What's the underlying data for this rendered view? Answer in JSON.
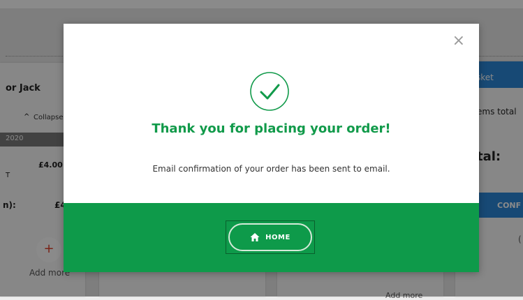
{
  "background": {
    "left_card": {
      "title": "or Jack",
      "collapse": "Collapse",
      "date": "2020",
      "price": "£4.00",
      "t_text": "T",
      "n_label": "n):",
      "f_price": "£4.",
      "plus": "+",
      "add_more": "Add more"
    },
    "right_card": {
      "basket": "sket",
      "items_total": "ems total",
      "total": "tal:",
      "confirm": "CONF",
      "c_text": "("
    },
    "middle_add_more": "Add more"
  },
  "modal": {
    "close": "×",
    "title": "Thank you for placing your order!",
    "message": "Email confirmation of your order has been sent to email.",
    "home_button": "HOME",
    "icons": {
      "success": "check-circle-icon",
      "home": "home-icon",
      "close": "close-icon"
    },
    "colors": {
      "accent": "#119a4a",
      "footer": "#0e9a4a"
    }
  }
}
